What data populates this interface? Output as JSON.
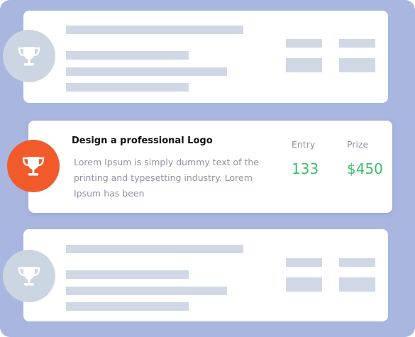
{
  "featured": {
    "title": "Design a professional Logo",
    "description": "Lorem Ipsum is simply dummy text of the printing and typesetting industry. Lorem Ipsum has been",
    "entry_label": "Entry",
    "entry_value": "133",
    "prize_label": "Prize",
    "prize_value": "$450"
  },
  "colors": {
    "background": "#a8b6e0",
    "accent_orange": "#f15a2b",
    "badge_grey": "#ccd5e2",
    "value_green": "#3cbf6a",
    "skeleton": "#cfd8e4"
  },
  "icons": {
    "trophy": "trophy-icon"
  }
}
